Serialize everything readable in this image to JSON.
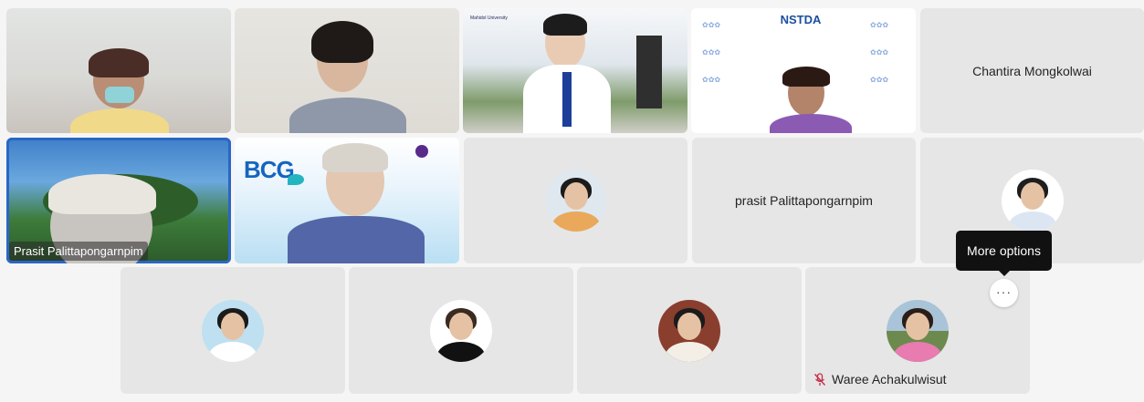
{
  "participants": {
    "p5_name": "Chantira Mongkolwai",
    "p6_label": "Prasit Palittapongarnpim",
    "p9_name": "prasit Palittapongarnpim",
    "p15_name": "Waree Achakulwisut"
  },
  "video_overlays": {
    "bcg_logo": "BCG",
    "nstda_logo": "NSTDA",
    "university_label": "Mahidol University"
  },
  "tooltip": {
    "more_options": "More options"
  },
  "more_button": {
    "label": "···"
  },
  "icons": {
    "more": "more-horizontal-icon",
    "mic_off": "mic-off-icon"
  },
  "colors": {
    "active_speaker_border": "#2a66c6",
    "tile_background": "#e6e6e6",
    "muted_icon": "#c4314b"
  }
}
